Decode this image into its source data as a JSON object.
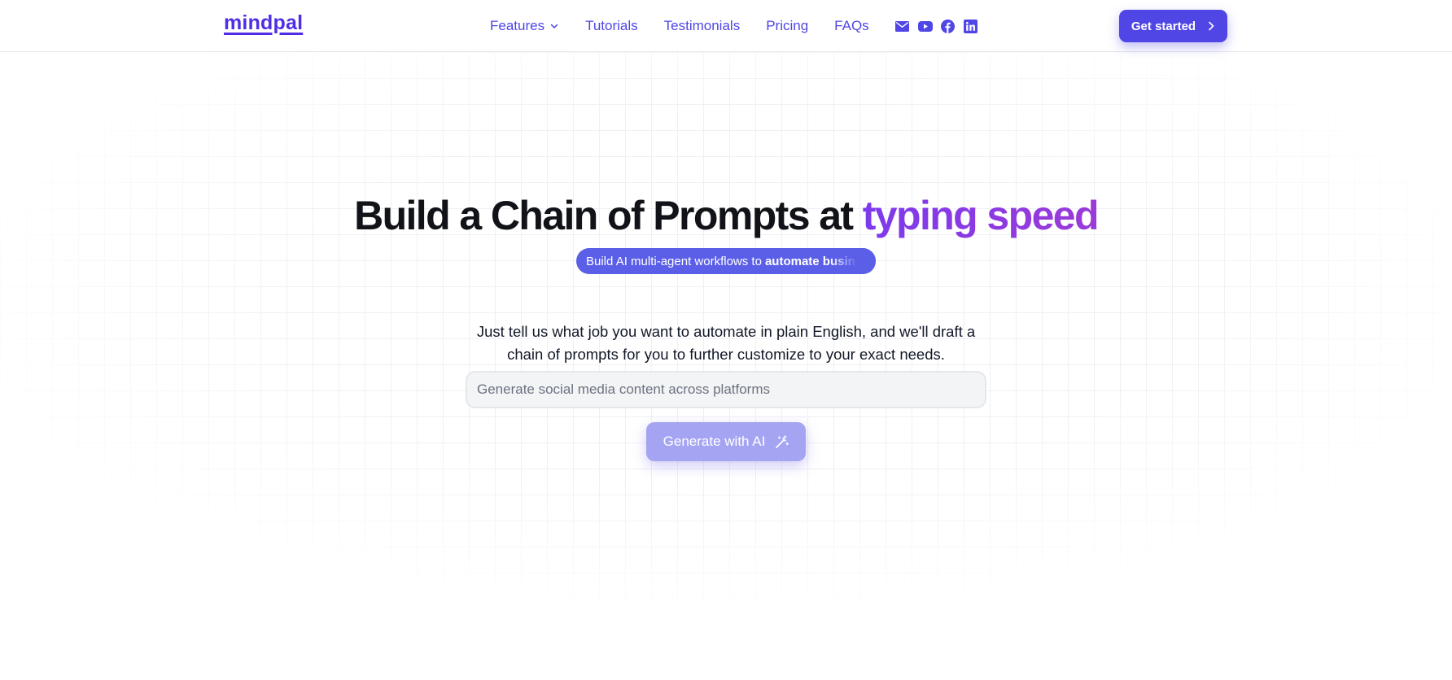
{
  "header": {
    "logo": "mindpal",
    "nav": [
      {
        "label": "Features",
        "has_dropdown": true
      },
      {
        "label": "Tutorials"
      },
      {
        "label": "Testimonials"
      },
      {
        "label": "Pricing"
      },
      {
        "label": "FAQs"
      }
    ],
    "social_icons": [
      "mail-icon",
      "youtube-icon",
      "facebook-icon",
      "linkedin-icon"
    ],
    "cta_label": "Get started"
  },
  "hero": {
    "title_main": "Build a Chain of Prompts at ",
    "title_accent": "typing speed",
    "pill_text": "Build AI multi-agent workflows to",
    "pill_bold": "automate busin",
    "description_line1": "Just tell us what job you want to automate in plain English, and we'll draft a",
    "description_line2": "chain of prompts for you to further customize to your exact needs.",
    "input_placeholder": "Generate social media content across platforms",
    "generate_label": "Generate with AI"
  },
  "colors": {
    "brand": "#4f46e5",
    "cta_bg": "#5046e5",
    "accent_gradient_start": "#7c3aed",
    "accent_gradient_end": "#9b3ad8",
    "pill_bg": "#5b5fe8",
    "generate_bg": "#a5a4f3"
  }
}
